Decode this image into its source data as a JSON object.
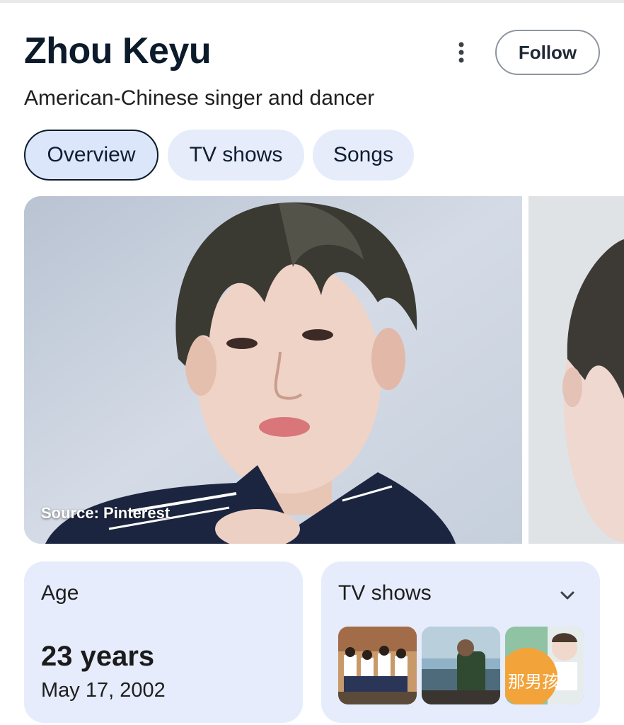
{
  "header": {
    "title": "Zhou Keyu",
    "subtitle": "American-Chinese singer and dancer",
    "follow_label": "Follow",
    "more_icon": "more-vertical-icon"
  },
  "tabs": [
    {
      "label": "Overview",
      "active": true
    },
    {
      "label": "TV shows",
      "active": false
    },
    {
      "label": "Songs",
      "active": false
    }
  ],
  "media": {
    "source_text": "Source: Pinterest"
  },
  "cards": {
    "age": {
      "label": "Age",
      "value": "23 years",
      "date": "May 17, 2002"
    },
    "tv_shows": {
      "label": "TV shows",
      "expand_icon": "chevron-down-icon",
      "thumbnails": [
        {
          "caption": ""
        },
        {
          "caption": ""
        },
        {
          "caption": "那男孩"
        }
      ]
    }
  },
  "colors": {
    "accent_bg": "#e6ecfb",
    "title_color": "#0b1b2b"
  }
}
